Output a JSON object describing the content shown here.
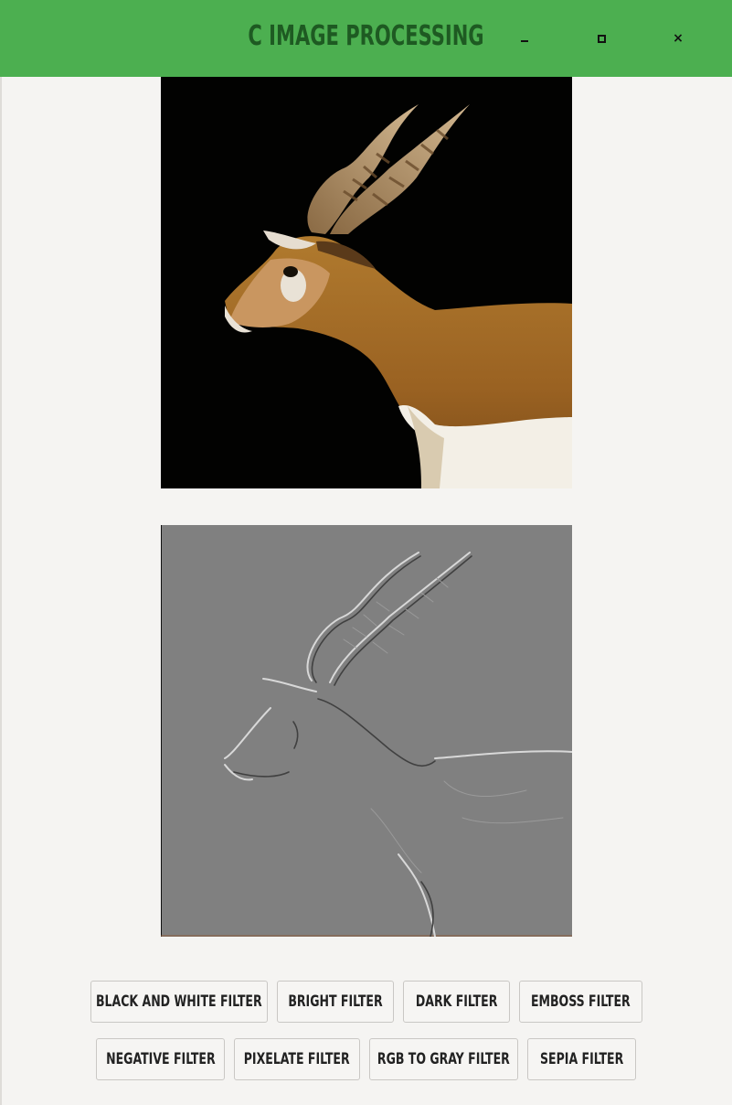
{
  "window": {
    "title": "C Image Processing",
    "minimize_glyph": "–",
    "maximize_glyph": "□",
    "close_glyph": "×",
    "accent": "#4caf50",
    "title_color": "#1e5a22"
  },
  "images": {
    "original": {
      "icon": "antelope-photo"
    },
    "filtered": {
      "icon": "antelope-emboss-photo"
    }
  },
  "filters": {
    "row1": [
      {
        "label": "Black and White Filter"
      },
      {
        "label": "Bright Filter"
      },
      {
        "label": "Dark Filter"
      },
      {
        "label": "Emboss Filter"
      }
    ],
    "row2": [
      {
        "label": "Negative Filter"
      },
      {
        "label": "Pixelate Filter"
      },
      {
        "label": "RGB to Gray Filter"
      },
      {
        "label": "Sepia Filter"
      }
    ]
  }
}
